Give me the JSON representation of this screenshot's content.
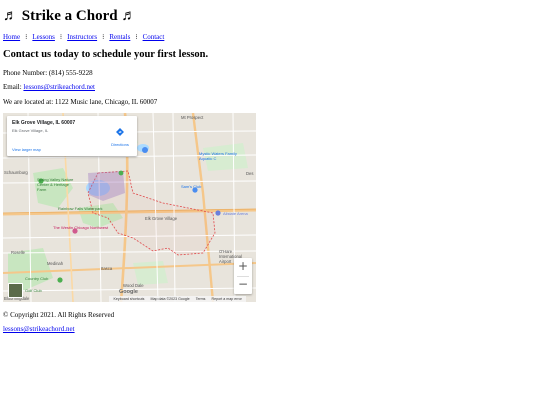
{
  "header": {
    "title": "♬ Strike a Chord ♬"
  },
  "nav": {
    "items": [
      {
        "label": "Home"
      },
      {
        "label": "Lessons"
      },
      {
        "label": "Instructors"
      },
      {
        "label": "Rentals"
      },
      {
        "label": "Contact"
      }
    ],
    "separator": "⁝"
  },
  "contact": {
    "heading": "Contact us today to schedule your first lesson.",
    "phone": "Phone Number: (814) 555-9228",
    "email_prefix": "Email: ",
    "email": "lessons@strikeachord.net",
    "location": "We are located at: 1122 Music lane, Chicago, IL 60007"
  },
  "map": {
    "place_name": "Elk Grove Village, IL 60007",
    "place_address": "Elk Grove Village, IL",
    "directions_label": "Directions",
    "view_larger": "View larger map",
    "zoom_in": "+",
    "zoom_out": "−",
    "google_logo": "Google",
    "footer_items": [
      "Keyboard shortcuts",
      "Map data ©2023 Google",
      "Terms",
      "Report a map error"
    ],
    "labels": {
      "mt_prospect": "Mt Prospect",
      "schaumburg": "Schaumburg",
      "elk_grove": "Elk Grove Village",
      "roselle": "Roselle",
      "medinah": "Medinah",
      "itasca": "Itasca",
      "wood_dale": "Wood Dale",
      "des_plaines": "Des",
      "ohare": "O'Hare International Airport",
      "bloomingdale": "Bloomingdale",
      "mystic_waters": "Mystic Waters Family Aquatic C",
      "sams_club": "Sam's Club",
      "allstate": "Allstate Arena",
      "westin": "The Westin Chicago Northwest",
      "rainbow_falls": "Rainbow Falls Waterpark",
      "spring_valley": "Spring Valley Nature Center & Heritage Farm",
      "country_club": "Country Club",
      "golf_club": "Golf Club"
    },
    "colors": {
      "land": "#e8e4dc",
      "park": "#c8e6c0",
      "highway": "#f5c78a",
      "road": "#ffffff",
      "boundary": "#e0484a",
      "water": "#aadaff",
      "link": "#1a73e8"
    }
  },
  "footer": {
    "copyright": "© Copyright 2021. All Rights Reserved",
    "email": "lessons@strikeachord.net"
  }
}
